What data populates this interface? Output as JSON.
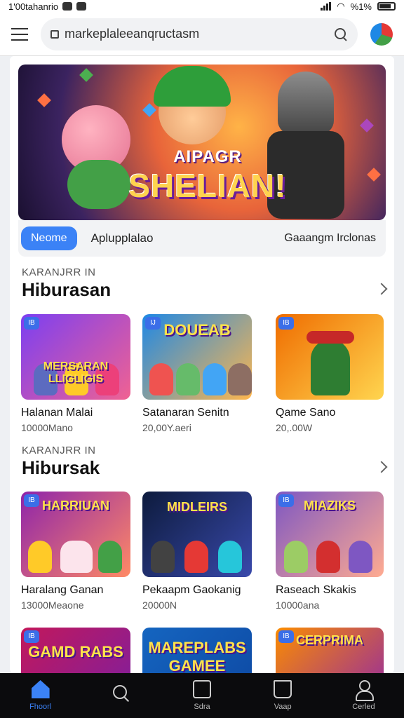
{
  "status_bar": {
    "left_text": "1'00tahanrio",
    "battery_text": "%1%"
  },
  "browser": {
    "url": "markeplaleeanqructasm"
  },
  "hero": {
    "subtitle": "AIPAGR",
    "title": "SHELIAN!",
    "tabs": {
      "active": "Neome",
      "second": "Aplupplalao",
      "right": "Gaaangm Irclonas"
    }
  },
  "sections": [
    {
      "label": "KARANJRR IN",
      "title": "Hiburasan",
      "items": [
        {
          "badge": "IB",
          "art_text": "MERSARAN LLIGLIGIS",
          "title": "Halanan Malai",
          "sub": "10000Mano",
          "colors": [
            "#7b3ff2",
            "#f06292"
          ]
        },
        {
          "badge": "IJ",
          "art_text": "DOUEAB",
          "title": "Satanaran Senitn",
          "sub": "20,00Y.aeri",
          "colors": [
            "#1e88e5",
            "#ffb74d"
          ]
        },
        {
          "badge": "IB",
          "art_text": "",
          "title": "Qame Sano",
          "sub": "20,.00W",
          "colors": [
            "#ef6c00",
            "#ffd54f"
          ]
        }
      ]
    },
    {
      "label": "KARANJRR IN",
      "title": "Hibursak",
      "items": [
        {
          "badge": "IB",
          "art_text": "HARRIUAN",
          "title": "Haralang Ganan",
          "sub": "13000Meaone",
          "colors": [
            "#8e24aa",
            "#ff8a65"
          ]
        },
        {
          "badge": "",
          "art_text": "MIDLEIRS",
          "title": "Pekaapm Gaokanig",
          "sub": "20000N",
          "colors": [
            "#0d1b3d",
            "#3949ab"
          ]
        },
        {
          "badge": "IB",
          "art_text": "MIAZIKS",
          "title": "Raseach Skakis",
          "sub": "10000ana",
          "colors": [
            "#7e57c2",
            "#ffab91"
          ]
        }
      ]
    },
    {
      "label": "",
      "title": "",
      "items": [
        {
          "badge": "IB",
          "art_text": "GAMD RABS",
          "title": "",
          "sub": "",
          "colors": [
            "#c2185b",
            "#7b1fa2"
          ]
        },
        {
          "badge": "",
          "art_text": "MAREPLABS GAMEE",
          "title": "",
          "sub": "",
          "colors": [
            "#1565c0",
            "#0d47a1"
          ]
        },
        {
          "badge": "IB",
          "art_text": "CERPRIMA",
          "title": "",
          "sub": "",
          "colors": [
            "#fb8c00",
            "#8e24aa"
          ]
        }
      ]
    }
  ],
  "bottom_nav": [
    {
      "label": "Fhoorl",
      "icon": "home-icon",
      "active": true
    },
    {
      "label": "",
      "icon": "search-icon",
      "active": false
    },
    {
      "label": "Sdra",
      "icon": "store-icon",
      "active": false
    },
    {
      "label": "Vaap",
      "icon": "book-icon",
      "active": false
    },
    {
      "label": "Cerled",
      "icon": "user-icon",
      "active": false
    }
  ],
  "colors": {
    "accent": "#3b82f6",
    "nav_bg": "#0b0b0d"
  }
}
